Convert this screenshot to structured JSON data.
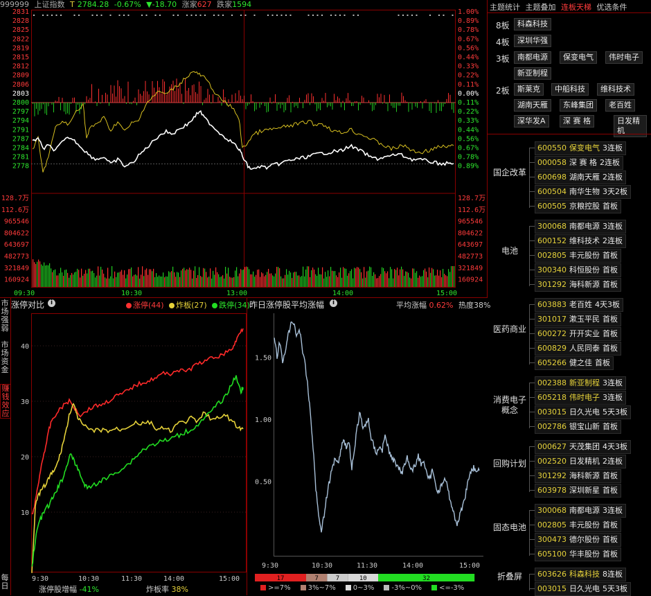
{
  "header": {
    "code": "999999",
    "name": "上证指数",
    "t_label": "T",
    "price": "2784.28",
    "pct": "-0.67%",
    "arrow": "▼",
    "change": "-18.70",
    "up_label": "涨家",
    "up_count": "627",
    "down_label": "跌家",
    "down_count": "1594"
  },
  "price_axis_left": [
    "2831",
    "2828",
    "2825",
    "2822",
    "2819",
    "2815",
    "2812",
    "2809",
    "2806",
    "2803",
    "2800",
    "2797",
    "2794",
    "2791",
    "2787",
    "2784",
    "2781",
    "2778"
  ],
  "price_axis_right": [
    "1.00%",
    "0.89%",
    "0.78%",
    "0.67%",
    "0.56%",
    "0.44%",
    "0.33%",
    "0.22%",
    "0.11%",
    "0.00%",
    "0.11%",
    "0.22%",
    "0.33%",
    "0.44%",
    "0.56%",
    "0.67%",
    "0.78%",
    "0.89%"
  ],
  "volume_axis_left": [
    "128.7万",
    "112.6万",
    "965546",
    "804622",
    "643697",
    "482773",
    "321849",
    "160924"
  ],
  "volume_axis_right": [
    "128.7万",
    "112.6万",
    "965546",
    "804622",
    "643697",
    "482773",
    "321849",
    "160924"
  ],
  "time_axis": [
    "09:30",
    "10:30",
    "13:00",
    "14:00",
    "15:00"
  ],
  "left_tabs": [
    {
      "label": "市场强弱",
      "active": false
    },
    {
      "label": "市场资金",
      "active": false
    },
    {
      "label": "赚钱效应",
      "active": true
    },
    {
      "label": "每日",
      "active": false
    }
  ],
  "compare_panel": {
    "title": "涨停对比",
    "legend": [
      {
        "label": "涨停(44)",
        "color": "#ff3030"
      },
      {
        "label": "炸板(27)",
        "color": "#e6d23a"
      },
      {
        "label": "跌停(34)",
        "color": "#22dd22"
      }
    ],
    "y_ticks": [
      "40",
      "30",
      "20",
      "10"
    ],
    "x_ticks": [
      "9:30",
      "10:30",
      "11:30",
      "14:00",
      "15:00"
    ],
    "footer_label1": "涨停股增幅",
    "footer_val1": "-41%",
    "footer_label2": "炸板率",
    "footer_val2": "38%"
  },
  "avg_panel": {
    "title": "昨日涨停股平均涨幅",
    "avg_label": "平均涨幅",
    "avg_value": "0.62%",
    "heat_label": "热度",
    "heat_value": "38%",
    "y_ticks": [
      "1.50",
      "1.00",
      "0.50"
    ],
    "x_ticks": [
      "9:30",
      "10:30",
      "11:30",
      "14:00",
      "15:00"
    ],
    "dist_bar": [
      {
        "value": "17",
        "color": "#e02020",
        "fraction": 0.227
      },
      {
        "value": "7",
        "color": "#b08070",
        "fraction": 0.093
      },
      {
        "value": "7",
        "color": "#cccccc",
        "fraction": 0.093
      },
      {
        "value": "10",
        "color": "#d8d8d8",
        "fraction": 0.133
      },
      {
        "value": "32",
        "color": "#22dd22",
        "fraction": 0.427
      }
    ],
    "dist_legend": [
      {
        "label": ">=7%",
        "color": "#e02020"
      },
      {
        "label": "3%~7%",
        "color": "#b08070"
      },
      {
        "label": "0~3%",
        "color": "#dddddd"
      },
      {
        "label": "-3%~0%",
        "color": "#bbbbbb"
      },
      {
        "label": "<=-3%",
        "color": "#22dd22"
      }
    ]
  },
  "right_tabs": [
    {
      "label": "主题统计",
      "active": false
    },
    {
      "label": "主题叠加",
      "active": false
    },
    {
      "label": "连板天梯",
      "active": true
    },
    {
      "label": "优选条件",
      "active": false
    }
  ],
  "ladder": [
    {
      "level": "8板",
      "stocks": [
        "科森科技"
      ]
    },
    {
      "level": "4板",
      "stocks": [
        "深圳华强"
      ]
    },
    {
      "level": "3板",
      "stocks": [
        "南都电源",
        "保变电气",
        "伟时电子",
        "新亚制程"
      ]
    },
    {
      "level": "2板",
      "stocks": [
        "斯莱克",
        "中船科技",
        "维科技术",
        "湖南天雁",
        "东峰集团",
        "老百姓",
        "深华发A",
        "深 赛 格",
        "日发精机"
      ]
    }
  ],
  "themes": [
    {
      "name": "国企改革",
      "rows": [
        {
          "code": "600550",
          "name": "保变电气",
          "desc": "3连板",
          "hl": true
        },
        {
          "code": "000058",
          "name": "深 赛 格",
          "desc": "2连板",
          "hl": false
        },
        {
          "code": "600698",
          "name": "湖南天雁",
          "desc": "2连板",
          "hl": false
        },
        {
          "code": "600504",
          "name": "南华生物",
          "desc": "3天2板",
          "hl": false
        },
        {
          "code": "600505",
          "name": "京粮控股",
          "desc": "首板",
          "hl": false
        }
      ]
    },
    {
      "name": "电池",
      "rows": [
        {
          "code": "300068",
          "name": "南都电源",
          "desc": "3连板",
          "hl": false
        },
        {
          "code": "600152",
          "name": "维科技术",
          "desc": "2连板",
          "hl": false
        },
        {
          "code": "002805",
          "name": "丰元股份",
          "desc": "首板",
          "hl": false
        },
        {
          "code": "300340",
          "name": "科恒股份",
          "desc": "首板",
          "hl": false
        },
        {
          "code": "301292",
          "name": "海科新源",
          "desc": "首板",
          "hl": false
        }
      ]
    },
    {
      "name": "医药商业",
      "rows": [
        {
          "code": "603883",
          "name": "老百姓",
          "desc": "4天3板",
          "hl": false
        },
        {
          "code": "301017",
          "name": "漱玉平民",
          "desc": "首板",
          "hl": false
        },
        {
          "code": "600272",
          "name": "开开实业",
          "desc": "首板",
          "hl": false
        },
        {
          "code": "600829",
          "name": "人民同泰",
          "desc": "首板",
          "hl": false
        },
        {
          "code": "605266",
          "name": "健之佳",
          "desc": "首板",
          "hl": false
        }
      ]
    },
    {
      "name": "消费电子概念",
      "rows": [
        {
          "code": "002388",
          "name": "新亚制程",
          "desc": "3连板",
          "hl": true
        },
        {
          "code": "605218",
          "name": "伟时电子",
          "desc": "3连板",
          "hl": true
        },
        {
          "code": "003015",
          "name": "日久光电",
          "desc": "5天3板",
          "hl": false
        },
        {
          "code": "002786",
          "name": "银宝山新",
          "desc": "首板",
          "hl": false
        }
      ]
    },
    {
      "name": "回购计划",
      "rows": [
        {
          "code": "000627",
          "name": "天茂集团",
          "desc": "4天3板",
          "hl": false
        },
        {
          "code": "002520",
          "name": "日发精机",
          "desc": "2连板",
          "hl": false
        },
        {
          "code": "301292",
          "name": "海科新源",
          "desc": "首板",
          "hl": false
        },
        {
          "code": "603978",
          "name": "深圳新星",
          "desc": "首板",
          "hl": false
        }
      ]
    },
    {
      "name": "固态电池",
      "rows": [
        {
          "code": "300068",
          "name": "南都电源",
          "desc": "3连板",
          "hl": false
        },
        {
          "code": "002805",
          "name": "丰元股份",
          "desc": "首板",
          "hl": false
        },
        {
          "code": "300473",
          "name": "德尔股份",
          "desc": "首板",
          "hl": false
        },
        {
          "code": "605100",
          "name": "华丰股份",
          "desc": "首板",
          "hl": false
        }
      ]
    },
    {
      "name": "折叠屏",
      "rows": [
        {
          "code": "603626",
          "name": "科森科技",
          "desc": "8连板",
          "hl": true
        },
        {
          "code": "003015",
          "name": "日久光电",
          "desc": "5天3板",
          "hl": false
        }
      ]
    }
  ],
  "colors": {
    "up": "#ff3b3b",
    "down": "#2ee82e",
    "yellow": "#e6d23a",
    "border": "#8b0000"
  }
}
